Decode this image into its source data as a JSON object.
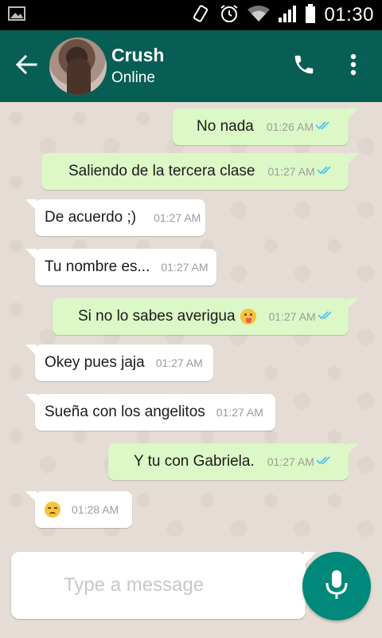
{
  "status_bar": {
    "time": "01:30",
    "icons": [
      "image-icon",
      "vibrate-icon",
      "alarm-icon",
      "wifi-icon",
      "signal-icon",
      "battery-icon"
    ]
  },
  "header": {
    "contact_name": "Crush",
    "contact_status": "Online",
    "icons": [
      "back-arrow-icon",
      "phone-icon",
      "more-vert-icon"
    ]
  },
  "messages": [
    {
      "dir": "out",
      "text": "No nada",
      "time": "01:26 AM",
      "read": true
    },
    {
      "dir": "out",
      "text": "Saliendo de la tercera clase",
      "time": "01:27 AM",
      "read": true
    },
    {
      "dir": "in",
      "text": "De acuerdo ;)",
      "time": "01:27 AM"
    },
    {
      "dir": "in",
      "text": "Tu nombre es...",
      "time": "01:27 AM"
    },
    {
      "dir": "out",
      "text": "Si no lo sabes averigua",
      "emoji": "tongue-emoji",
      "time": "01:27 AM",
      "read": true
    },
    {
      "dir": "in",
      "text": "Okey pues jaja",
      "time": "01:27 AM"
    },
    {
      "dir": "in",
      "text": "Sueña con los angelitos",
      "time": "01:27 AM"
    },
    {
      "dir": "out",
      "text": "Y tu con Gabriela.",
      "time": "01:27 AM",
      "read": true
    },
    {
      "dir": "in",
      "text": "",
      "emoji": "unamused-emoji",
      "time": "01:28 AM"
    }
  ],
  "composer": {
    "placeholder": "Type a message",
    "value": ""
  },
  "colors": {
    "app_bar": "#075e54",
    "outgoing_bubble": "#dcf8c6",
    "incoming_bubble": "#ffffff",
    "read_ticks": "#4fc3f7",
    "mic_button": "#00897b",
    "chat_background": "#e5ddd5"
  }
}
